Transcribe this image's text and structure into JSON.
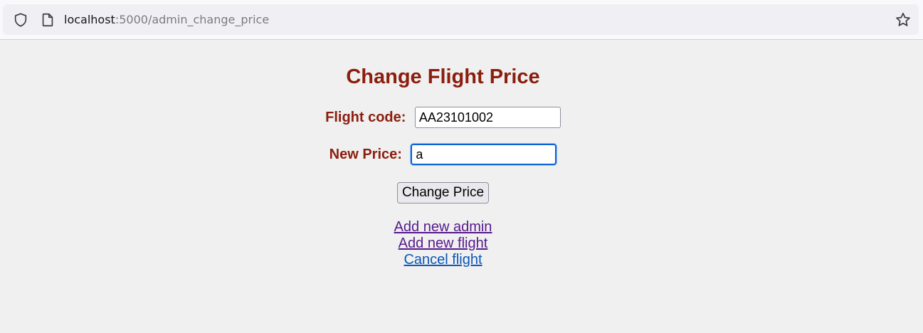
{
  "browser": {
    "url_host": "localhost",
    "url_path": ":5000/admin_change_price",
    "icons": [
      "shield-icon",
      "page-icon",
      "star-icon"
    ]
  },
  "page": {
    "title": "Change Flight Price",
    "flight_code_label": "Flight code:",
    "flight_code_value": "AA23101002",
    "new_price_label": "New Price:",
    "new_price_value": "a",
    "submit_label": "Change Price",
    "links": [
      {
        "label": "Add new admin",
        "state": "visited"
      },
      {
        "label": "Add new flight",
        "state": "visited"
      },
      {
        "label": "Cancel flight",
        "state": "unvisited"
      }
    ]
  },
  "colors": {
    "heading": "#8b1e0e",
    "visited_link": "#551a8b",
    "unvisited_link": "#0b57b8",
    "focus_ring": "#0b63d9",
    "background": "#f0f0f0"
  }
}
